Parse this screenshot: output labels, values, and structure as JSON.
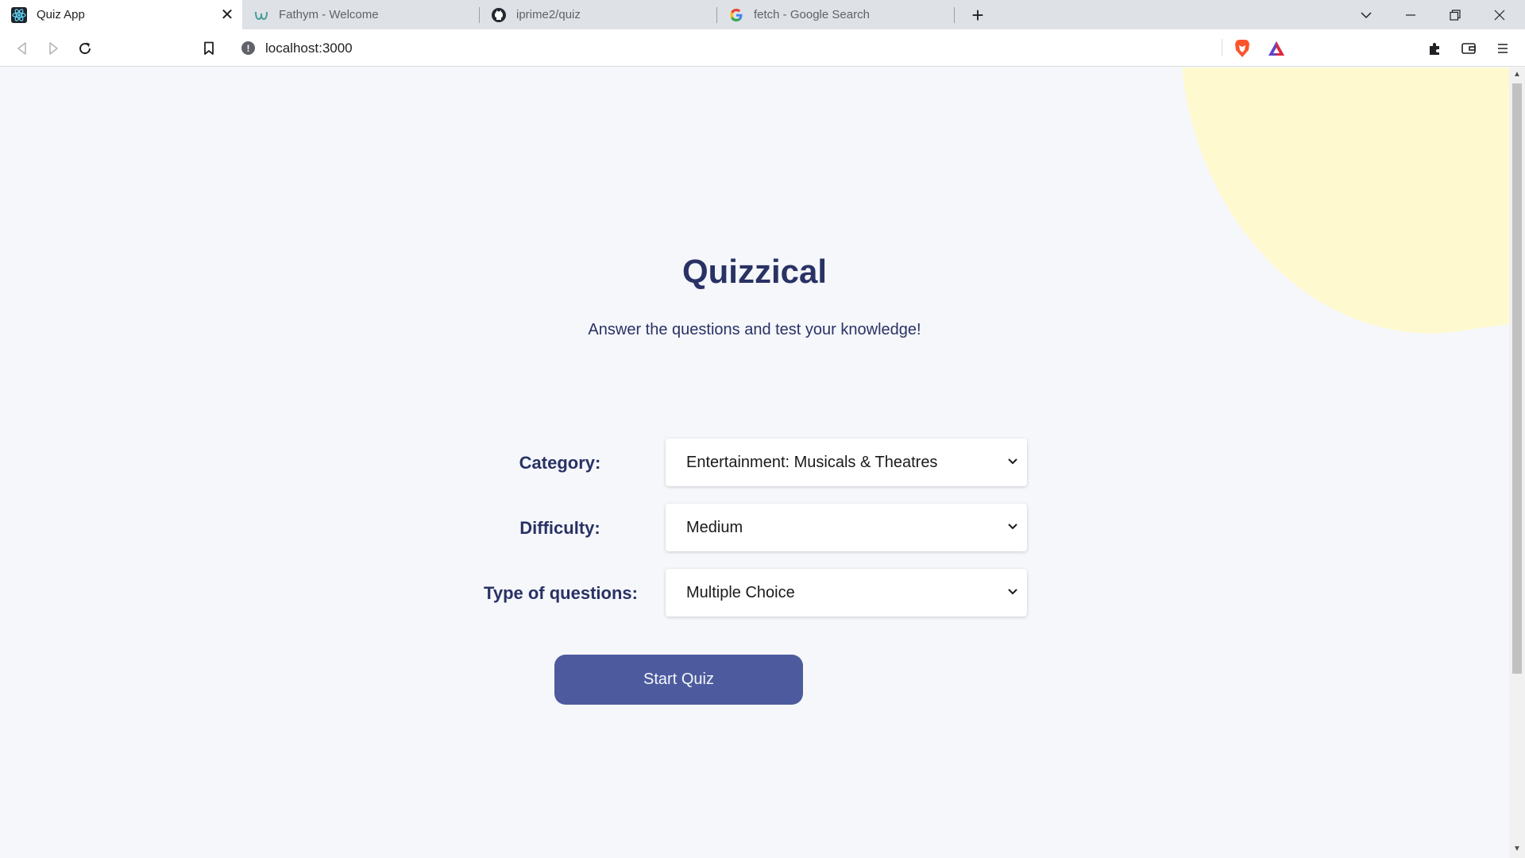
{
  "browser": {
    "tabs": [
      {
        "label": "Quiz App",
        "icon": "react-icon",
        "active": true
      },
      {
        "label": "Fathym - Welcome",
        "icon": "fathym-icon",
        "active": false
      },
      {
        "label": "iprime2/quiz",
        "icon": "github-icon",
        "active": false
      },
      {
        "label": "fetch - Google Search",
        "icon": "google-icon",
        "active": false
      }
    ],
    "url": "localhost:3000"
  },
  "page": {
    "title": "Quizzical",
    "subtitle": "Answer the questions and test your knowledge!",
    "form": {
      "category": {
        "label": "Category:",
        "value": "Entertainment: Musicals & Theatres"
      },
      "difficulty": {
        "label": "Difficulty:",
        "value": "Medium"
      },
      "type": {
        "label": "Type of questions:",
        "value": "Multiple Choice"
      }
    },
    "start_button": "Start Quiz"
  },
  "colors": {
    "accent": "#4d5b9e",
    "text": "#293264",
    "background": "#f6f7fb",
    "blob": "#fff9d0"
  }
}
